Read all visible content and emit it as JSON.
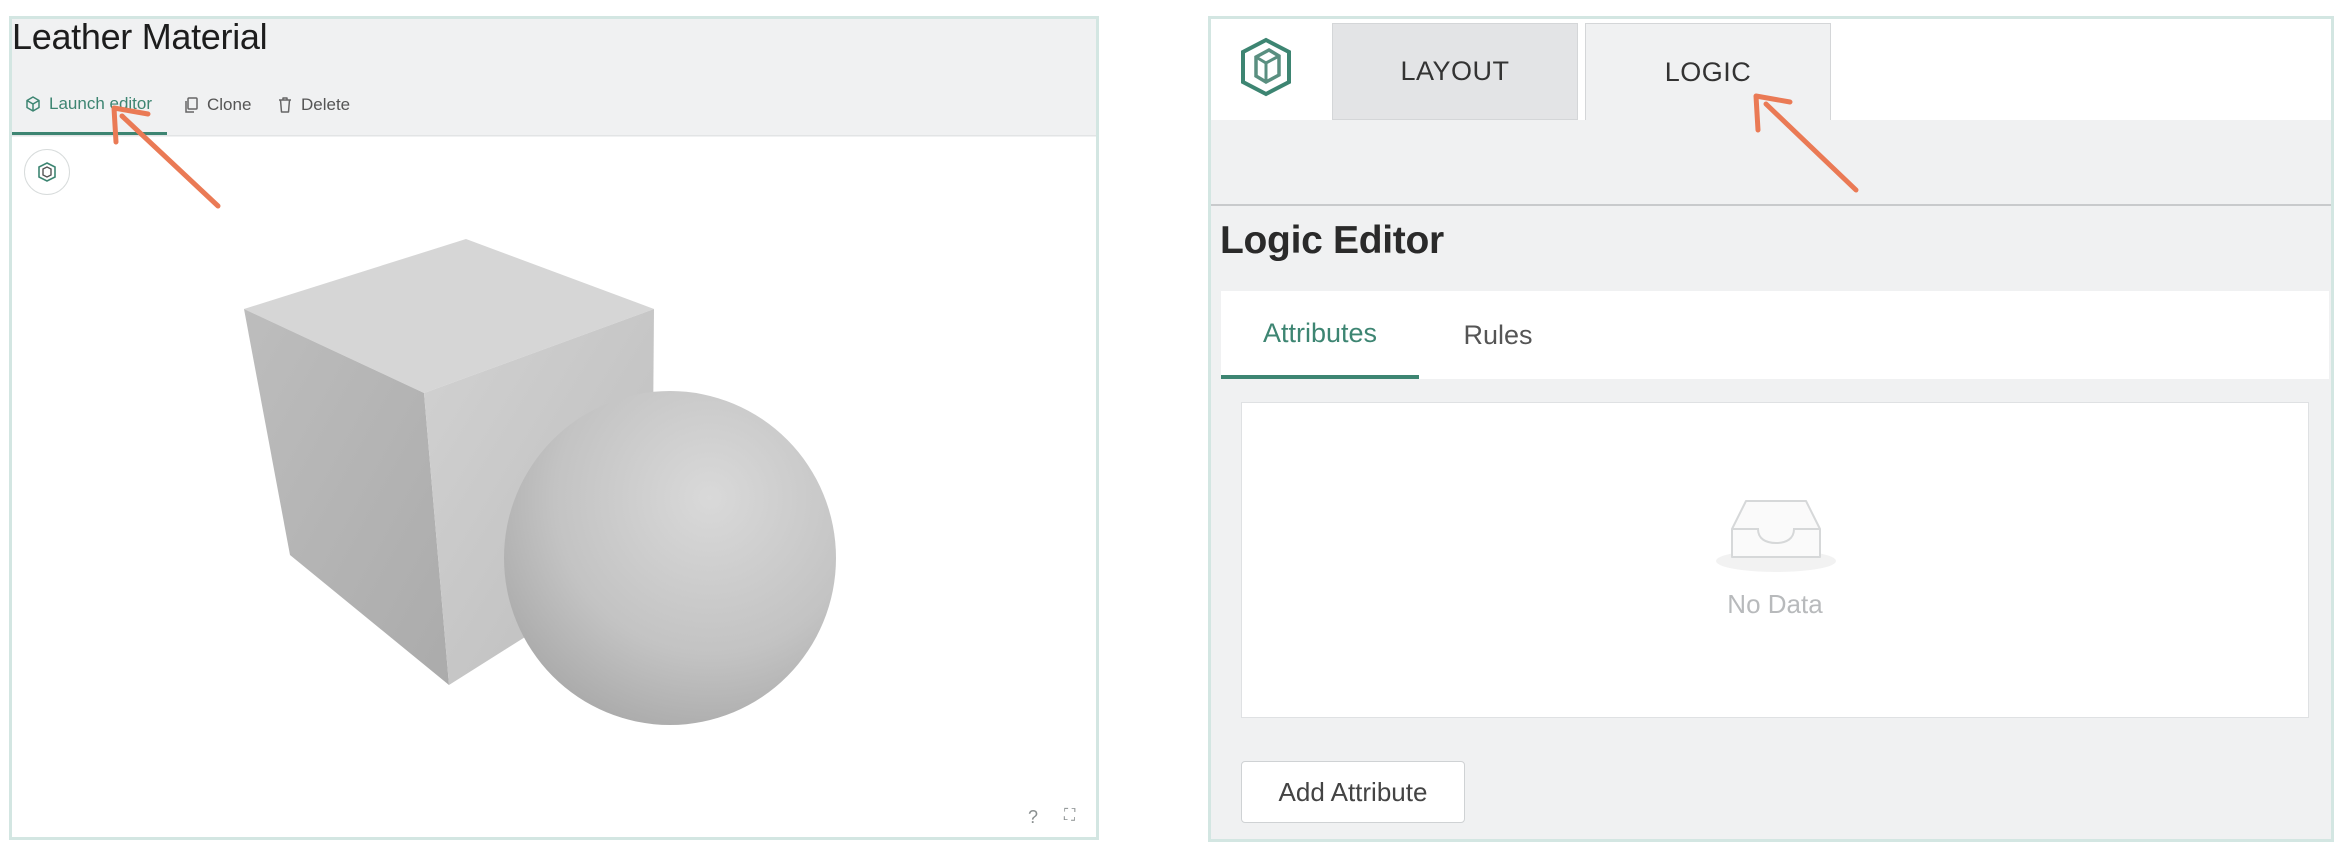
{
  "left_panel": {
    "title": "Leather Material",
    "toolbar": {
      "launch_label": "Launch editor",
      "clone_label": "Clone",
      "delete_label": "Delete"
    },
    "viewport": {
      "help_symbol": "?",
      "fullscreen_symbol": "⛶"
    }
  },
  "right_panel": {
    "top_tabs": {
      "layout_label": "LAYOUT",
      "logic_label": "LOGIC"
    },
    "section_title": "Logic Editor",
    "sub_tabs": {
      "attributes_label": "Attributes",
      "rules_label": "Rules"
    },
    "empty_state": {
      "text": "No Data"
    },
    "add_button_label": "Add Attribute"
  },
  "colors": {
    "accent": "#3d8572",
    "annotation_arrow": "#ea7a55",
    "panel_border": "#d3e6e2",
    "panel_bg": "#f0f1f2"
  },
  "icons": {
    "launch": "cube-icon",
    "clone": "copy-icon",
    "delete": "trash-icon",
    "brand": "logo-icon",
    "empty": "inbox-icon"
  }
}
